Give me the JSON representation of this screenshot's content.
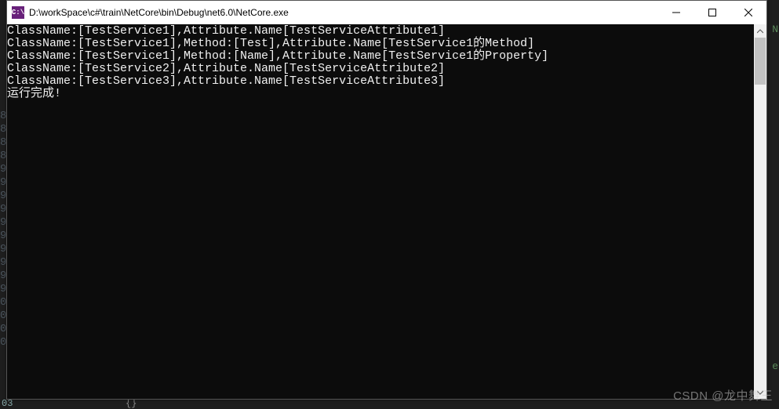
{
  "window": {
    "title": "D:\\workSpace\\c#\\train\\NetCore\\bin\\Debug\\net6.0\\NetCore.exe",
    "icon_label": "C:\\"
  },
  "console": {
    "lines": [
      "ClassName:[TestService1],Attribute.Name[TestServiceAttribute1]",
      "ClassName:[TestService1],Method:[Test],Attribute.Name[TestService1的Method]",
      "ClassName:[TestService1],Method:[Name],Attribute.Name[TestService1的Property]",
      "ClassName:[TestService2],Attribute.Name[TestServiceAttribute2]",
      "ClassName:[TestService3],Attribute.Name[TestServiceAttribute3]",
      "运行完成!"
    ]
  },
  "gutter": {
    "numbers": [
      "8",
      "8",
      "8",
      "8",
      "9",
      "9",
      "9",
      "9",
      "9",
      "9",
      "9",
      "9",
      "9",
      "9",
      "0",
      "0",
      "0",
      "0"
    ]
  },
  "right_hints": [
    "N",
    "e"
  ],
  "bottom_fragments": [
    "03",
    "{}"
  ],
  "watermark": "CSDN @龙中舞王"
}
